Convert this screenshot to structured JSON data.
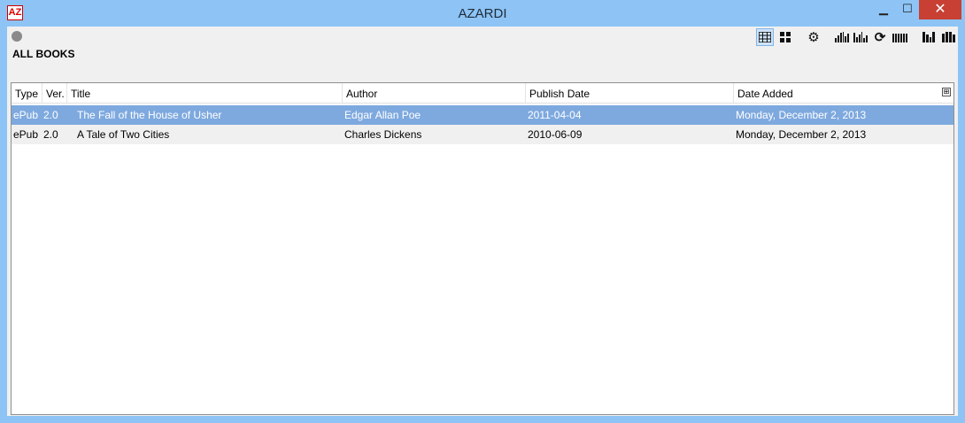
{
  "window": {
    "title": "AZARDI",
    "app_icon_text": "AZ"
  },
  "library": {
    "heading": "ALL BOOKS"
  },
  "toolbar": {
    "buttons": [
      "list-view",
      "grid-view",
      "settings",
      "sort",
      "sort-descending",
      "refresh",
      "library",
      "add-book",
      "bookshelf"
    ],
    "active": "list-view"
  },
  "table": {
    "columns": [
      "Type",
      "Ver.",
      "Title",
      "Author",
      "Publish Date",
      "Date Added"
    ],
    "rows": [
      {
        "type": "ePub",
        "ver": "2.0",
        "title": "The Fall of the House of Usher",
        "author": "Edgar Allan Poe",
        "publish_date": "2011-04-04",
        "date_added": "Monday, December 2, 2013",
        "selected": true
      },
      {
        "type": "ePub",
        "ver": "2.0",
        "title": "A Tale of Two Cities",
        "author": "Charles Dickens",
        "publish_date": "2010-06-09",
        "date_added": "Monday, December 2, 2013",
        "selected": false
      }
    ]
  },
  "colors": {
    "titlebar": "#8dc4f5",
    "selection": "#7ea9df",
    "close_button": "#c84034"
  }
}
